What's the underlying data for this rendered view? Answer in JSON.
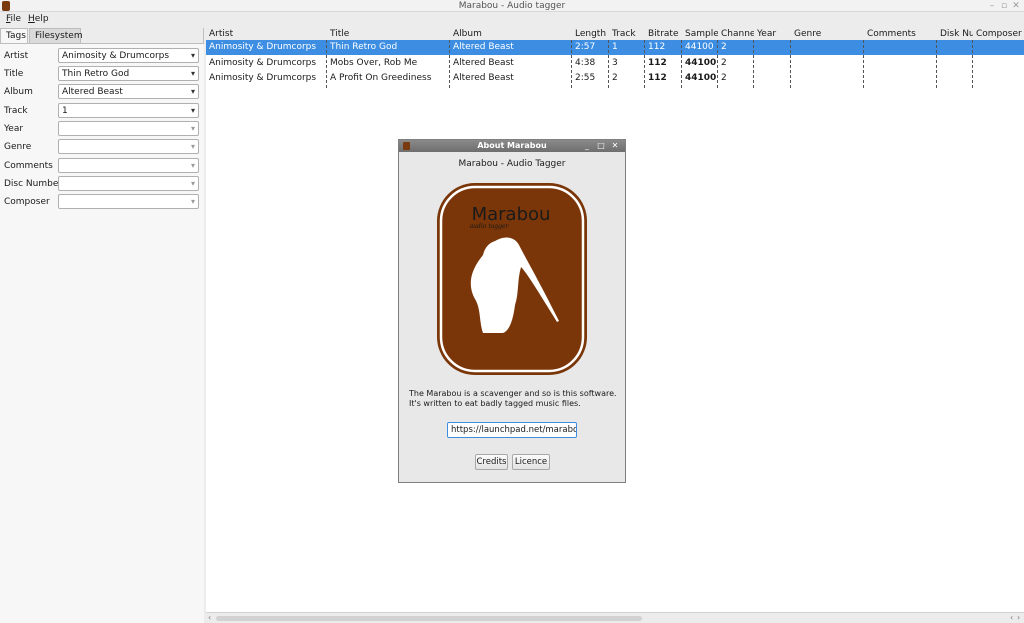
{
  "window": {
    "title": "Marabou - Audio tagger"
  },
  "menu": [
    {
      "accel": "F",
      "rest": "ile"
    },
    {
      "accel": "H",
      "rest": "elp"
    }
  ],
  "tabs": [
    {
      "label": "Tags",
      "active": true
    },
    {
      "label": "Filesystem",
      "active": false
    }
  ],
  "fields": [
    {
      "label": "Artist",
      "value": "Animosity & Drumcorps"
    },
    {
      "label": "Title",
      "value": "Thin Retro God"
    },
    {
      "label": "Album",
      "value": "Altered Beast"
    },
    {
      "label": "Track",
      "value": "1"
    },
    {
      "label": "Year",
      "value": ""
    },
    {
      "label": "Genre",
      "value": ""
    },
    {
      "label": "Comments",
      "value": ""
    },
    {
      "label": "Disc Number",
      "value": ""
    },
    {
      "label": "Composer",
      "value": ""
    }
  ],
  "table": {
    "columns": [
      "Artist",
      "Title",
      "Album",
      "Length",
      "Track",
      "Bitrate",
      "Sample",
      "Channe",
      "Year",
      "Genre",
      "Comments",
      "Disk Nu",
      "Composer"
    ],
    "rows": [
      {
        "selected": true,
        "cells": [
          "Animosity & Drumcorps",
          "Thin Retro God",
          "Altered Beast",
          "2:57",
          "1",
          "112",
          "44100",
          "2",
          "",
          "",
          "",
          "",
          ""
        ]
      },
      {
        "selected": false,
        "cells": [
          "Animosity & Drumcorps",
          "Mobs Over, Rob Me",
          "Altered Beast",
          "4:38",
          "3",
          "112",
          "44100",
          "2",
          "",
          "",
          "",
          "",
          ""
        ]
      },
      {
        "selected": false,
        "cells": [
          "Animosity & Drumcorps",
          "A Profit On Greediness",
          "Altered Beast",
          "2:55",
          "2",
          "112",
          "44100",
          "2",
          "",
          "",
          "",
          "",
          ""
        ]
      }
    ]
  },
  "about": {
    "title": "About Marabou",
    "app_name": "Marabou - Audio Tagger",
    "logo_title": "Marabou",
    "logo_subtitle": "audio tagger",
    "description": "The Marabou is a scavenger and so is this software. It's written to eat badly tagged music files.",
    "url": "https://launchpad.net/marabou",
    "credits_label": "Credits",
    "licence_label": "Licence"
  },
  "colors": {
    "selection": "#3d8ee2",
    "logo_brown": "#7a3608",
    "dialog_titlebar": "#7a7a7a"
  },
  "icons": [
    "app-icon",
    "minimize-icon",
    "maximize-icon",
    "close-icon",
    "dropdown-arrow-icon",
    "scroll-left-icon",
    "scroll-right-icon"
  ]
}
